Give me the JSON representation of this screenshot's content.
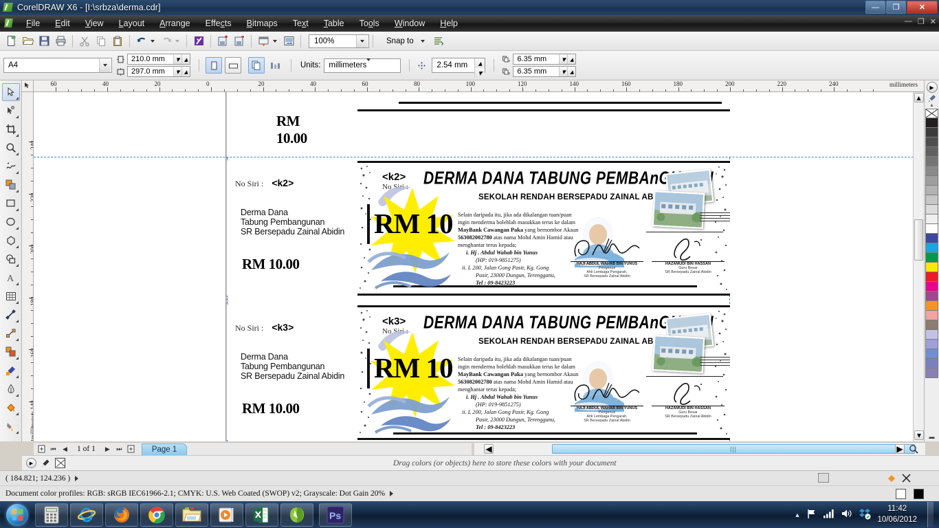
{
  "window": {
    "title": "CorelDRAW X6 - [I:\\srbza\\derma.cdr]",
    "app_icon": "coreldraw-icon",
    "minimize": "—",
    "maximize": "❐",
    "close": "✕",
    "doc_minimize": "—",
    "doc_maximize": "❐",
    "doc_close": "✕"
  },
  "menubar": {
    "items": [
      {
        "label": "File",
        "accel": "F"
      },
      {
        "label": "Edit",
        "accel": "E"
      },
      {
        "label": "View",
        "accel": "V"
      },
      {
        "label": "Layout",
        "accel": "L"
      },
      {
        "label": "Arrange",
        "accel": "A"
      },
      {
        "label": "Effects",
        "accel": "c"
      },
      {
        "label": "Bitmaps",
        "accel": "B"
      },
      {
        "label": "Text",
        "accel": "x"
      },
      {
        "label": "Table",
        "accel": "T"
      },
      {
        "label": "Tools",
        "accel": "o"
      },
      {
        "label": "Window",
        "accel": "W"
      },
      {
        "label": "Help",
        "accel": "H"
      }
    ]
  },
  "toolbar": {
    "buttons": [
      {
        "name": "new-document-button",
        "icon": "new-page-icon"
      },
      {
        "name": "open-button",
        "icon": "folder-open-icon"
      },
      {
        "name": "save-button",
        "icon": "floppy-disk-icon"
      },
      {
        "name": "print-button",
        "icon": "printer-icon"
      },
      {
        "name": "cut-button",
        "icon": "scissors-icon"
      },
      {
        "name": "copy-button",
        "icon": "copy-icon"
      },
      {
        "name": "paste-button",
        "icon": "clipboard-icon"
      },
      {
        "name": "undo-button",
        "icon": "undo-arrow-icon"
      },
      {
        "name": "redo-button",
        "icon": "redo-arrow-icon"
      },
      {
        "name": "corel-connect-button",
        "icon": "corel-connect-icon"
      },
      {
        "name": "import-button",
        "icon": "import-icon"
      },
      {
        "name": "export-button",
        "icon": "export-icon"
      },
      {
        "name": "publish-pdf-button",
        "icon": "pdf-export-icon"
      },
      {
        "name": "application-launcher-button",
        "icon": "launcher-icon"
      }
    ],
    "zoom_level": "100%",
    "snap_to_label": "Snap to",
    "options_icon": "options-icon"
  },
  "propertybar": {
    "paper_type": "A4",
    "page_width": "210.0 mm",
    "page_height": "297.0 mm",
    "orientation_portrait_icon": "portrait-icon",
    "orientation_landscape_icon": "landscape-icon",
    "all_pages_icon": "all-pages-icon",
    "current_page_icon": "current-page-icon",
    "units_label": "Units:",
    "units_value": "millimeters",
    "nudge_value": "2.54 mm",
    "duplicate_x": "6.35 mm",
    "duplicate_y": "6.35 mm"
  },
  "toolbox": {
    "tools": [
      {
        "name": "pick-tool",
        "icon": "arrow-cursor-icon",
        "selected": true
      },
      {
        "name": "shape-tool",
        "icon": "node-edit-icon",
        "selected": false
      },
      {
        "name": "crop-tool",
        "icon": "crop-icon",
        "selected": false
      },
      {
        "name": "zoom-tool",
        "icon": "magnifier-icon",
        "selected": false
      },
      {
        "name": "freehand-tool",
        "icon": "freehand-curve-icon",
        "selected": false
      },
      {
        "name": "smart-fill-tool",
        "icon": "smart-fill-icon",
        "selected": false
      },
      {
        "name": "rectangle-tool",
        "icon": "rectangle-icon",
        "selected": false
      },
      {
        "name": "ellipse-tool",
        "icon": "ellipse-icon",
        "selected": false
      },
      {
        "name": "polygon-tool",
        "icon": "polygon-icon",
        "selected": false
      },
      {
        "name": "basic-shapes-tool",
        "icon": "basic-shapes-icon",
        "selected": false
      },
      {
        "name": "text-tool",
        "icon": "letter-a-icon",
        "selected": false
      },
      {
        "name": "table-tool",
        "icon": "grid-table-icon",
        "selected": false
      },
      {
        "name": "dimension-tool",
        "icon": "dimension-line-icon",
        "selected": false
      },
      {
        "name": "connector-tool",
        "icon": "connector-line-icon",
        "selected": false
      },
      {
        "name": "blend-tool",
        "icon": "blend-squares-icon",
        "selected": false
      },
      {
        "name": "color-eyedropper-tool",
        "icon": "eyedropper-icon",
        "selected": false
      },
      {
        "name": "outline-tool",
        "icon": "pen-nib-icon",
        "selected": false
      },
      {
        "name": "fill-tool",
        "icon": "paint-bucket-icon",
        "selected": false
      },
      {
        "name": "interactive-fill-tool",
        "icon": "interactive-fill-icon",
        "selected": false
      }
    ]
  },
  "rulers": {
    "horizontal_ticks": [
      "60",
      "40",
      "20",
      "0",
      "20",
      "40",
      "60",
      "80",
      "100",
      "120",
      "140",
      "160",
      "180",
      "200",
      "220",
      "240"
    ],
    "horizontal_unit_label": "millimeters",
    "vertical_ticks": [
      "240",
      "220",
      "200",
      "180",
      "160",
      "140"
    ],
    "vertical_unit_label": "millimeters"
  },
  "document": {
    "tickets": [
      {
        "id": "ticket-1",
        "serial_code": "",
        "stub_price": "RM 10.00",
        "partial": true
      },
      {
        "id": "ticket-2",
        "serial_code": "<k2>",
        "no_siri_label": "No Siri :",
        "stub_lines": [
          "Derma Dana",
          "Tabung Pembangunan",
          "SR Bersepadu Zainal Abidin"
        ],
        "stub_price": "RM 10.00",
        "partial": false
      },
      {
        "id": "ticket-3",
        "serial_code": "<k3>",
        "no_siri_label": "No Siri :",
        "stub_lines": [
          "Derma Dana",
          "Tabung Pembangunan",
          "SR Bersepadu Zainal Abidin"
        ],
        "stub_price": "RM 10.00",
        "partial": false
      }
    ],
    "artwork": {
      "title": "DERMA DANA TABUNG PEMBAnGUNAN",
      "subtitle": "SEKOLAH RENDAH BERSEPADU ZAINAL ABIDIN",
      "amount": "RM 10",
      "no_siri_label": "No Siri :",
      "body_line_1": "Selain daripada itu, jika ada dikalangan tuan/puan",
      "body_line_2": "ingin menderma bolehlah masukkan terus ke dalam",
      "body_bank": "MayBank Cawangan Paka",
      "body_line_3b": " yang bernombor Akaun",
      "body_account": "563082002780",
      "body_line_4b": " atas nama Mohd Amin Hamid atau",
      "body_line_5": "menghantar terus kepada;",
      "contact_1_num": "i.",
      "contact_1_name": "Hj . Abdul Wahab bin Yunus",
      "contact_1_phone": "(HP: 019-9851275)",
      "contact_2_num": "ii.",
      "contact_2_addr1": "L 200, Jalan Gong Pasir, Kg. Gong",
      "contact_2_addr2": "Pasir, 23000 Dungun, Terengganu,",
      "contact_2_tel": "Tel : 09-8423223",
      "signatory_1_name": "HAJI ABDUL WAHAB BIN YUNUS",
      "signatory_1_role": "Pengerusi",
      "signatory_1_org1": "Ahli Lembaga Pengarah,",
      "signatory_1_org2": "SR Bersepadu Zainal Abidin",
      "signatory_2_name": "HAZAMUDI BIN HASSAN",
      "signatory_2_role": "Guru Besar",
      "signatory_2_org1": "SR Bersepadu Zainal Abidin"
    }
  },
  "pagenav": {
    "add_page_start_icon": "add-page-icon",
    "first_icon": "first-page-icon",
    "prev_icon": "prev-page-icon",
    "counter": "1 of 1",
    "next_icon": "next-page-icon",
    "last_icon": "last-page-icon",
    "add_page_end_icon": "add-page-icon",
    "tab_label": "Page 1"
  },
  "colordock": {
    "message": "Drag colors (or objects) here to store these colors with your document",
    "nav_icon": "palette-nav-icon",
    "eyedropper_icon": "eyedropper-icon",
    "no-color_icon": "no-color-icon"
  },
  "statusbar": {
    "coordinates": "( 184.821; 124.236 )",
    "color_profiles": "Document color profiles: RGB: sRGB IEC61966-2.1; CMYK: U.S. Web Coated (SWOP) v2; Grayscale: Dot Gain 20%",
    "fill_swatch_color": "#ffffff",
    "outline_swatch_color": "#000000"
  },
  "palette": {
    "no_color": "#ffffff",
    "swatches": [
      "#231f20",
      "#3c3c3c",
      "#4e4e4e",
      "#616161",
      "#757575",
      "#8a8a8a",
      "#9e9e9e",
      "#b3b3b3",
      "#c7c7c7",
      "#dcdcdc",
      "#efefef",
      "#ffffff",
      "#3b4aa0",
      "#17a8e0",
      "#009a49",
      "#ffe800",
      "#ed1c24",
      "#ec008c",
      "#a1468f",
      "#f7941e",
      "#f4a2a2",
      "#8c7b6e",
      "#c3c2e6",
      "#9f9fd9",
      "#6f8fd0",
      "#7b7fc0",
      "#8a7fb5"
    ]
  },
  "taskbar": {
    "items": [
      {
        "name": "taskbar-start-button",
        "icon": "windows-orb-icon"
      },
      {
        "name": "taskbar-calculator",
        "icon": "calculator-icon"
      },
      {
        "name": "taskbar-internet-explorer",
        "icon": "internet-explorer-icon"
      },
      {
        "name": "taskbar-firefox",
        "icon": "firefox-icon"
      },
      {
        "name": "taskbar-chrome",
        "icon": "chrome-icon"
      },
      {
        "name": "taskbar-explorer",
        "icon": "folder-icon"
      },
      {
        "name": "taskbar-media-player",
        "icon": "media-player-icon"
      },
      {
        "name": "taskbar-excel",
        "icon": "excel-icon"
      },
      {
        "name": "taskbar-coreldraw",
        "icon": "coreldraw-icon"
      },
      {
        "name": "taskbar-photoshop",
        "icon": "photoshop-icon"
      }
    ],
    "tray": {
      "show_hidden_icon": "chevron-up-icon",
      "flag_icon": "action-center-flag-icon",
      "network_icon": "network-bars-icon",
      "volume_icon": "speaker-icon",
      "dropbox_icon": "dropbox-icon",
      "time": "11:42",
      "date": "10/06/2012"
    }
  }
}
